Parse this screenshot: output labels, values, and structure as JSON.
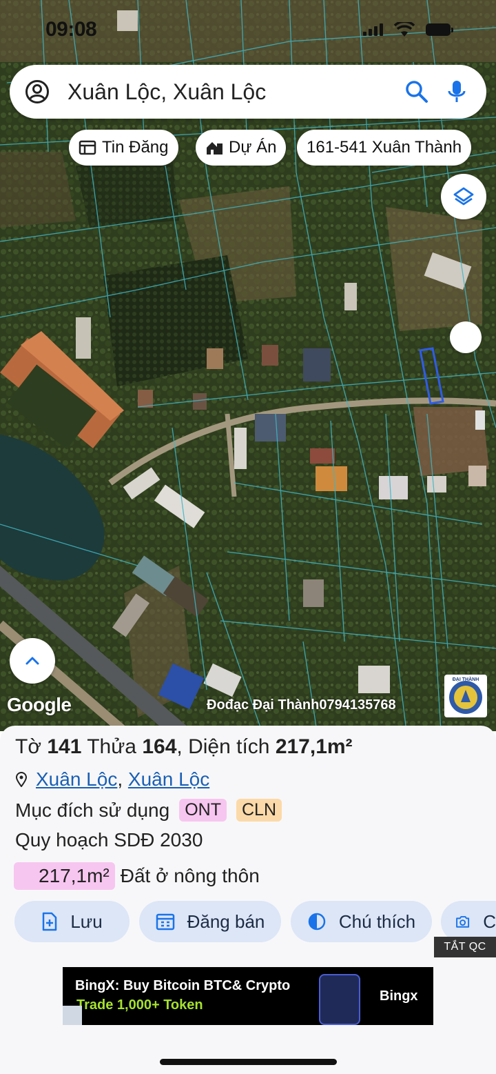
{
  "status_bar": {
    "time": "09:08"
  },
  "search": {
    "text": "Xuân Lộc, Xuân Lộc"
  },
  "chips": [
    {
      "label": "Tin Đăng",
      "icon": "listing-icon"
    },
    {
      "label": "Dự Án",
      "icon": "building-icon"
    },
    {
      "label": "161-541 Xuân Thành",
      "icon": ""
    }
  ],
  "map": {
    "attribution": "Google",
    "watermark": "Đođạc Đại Thành0794135768",
    "seal_text": "ĐẠI THÀNH"
  },
  "parcel": {
    "sheet_label": "Tờ",
    "sheet_no": "141",
    "plot_label": "Thửa",
    "plot_no": "164",
    "area_label": "Diện tích",
    "area": "217,1m²",
    "location_1": "Xuân Lộc",
    "location_sep": ", ",
    "location_2": "Xuân Lộc",
    "purpose_label": "Mục đích sử dụng",
    "purpose_tags": [
      "ONT",
      "CLN"
    ],
    "plan": "Quy hoạch SDĐ 2030",
    "land_area": "217,1m²",
    "land_type": "Đất ở nông thôn"
  },
  "actions": [
    {
      "label": "Lưu",
      "icon": "save-add-icon"
    },
    {
      "label": "Đăng bán",
      "icon": "calendar-icon"
    },
    {
      "label": "Chú thích",
      "icon": "contrast-icon"
    },
    {
      "label": "C",
      "icon": "camera-icon"
    }
  ],
  "ad": {
    "close_label": "TẮT QC",
    "line1": "BingX: Buy Bitcoin BTC& Crypto",
    "line2": "Trade 1,000+ Token",
    "brand": "Bingx"
  }
}
